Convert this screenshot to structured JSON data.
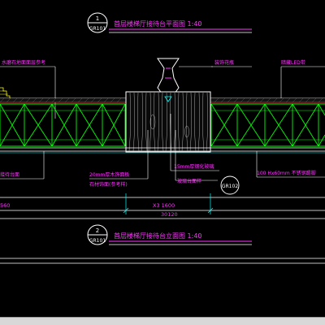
{
  "drawing": {
    "section_view": {
      "marker_number": "1",
      "marker_sheet": "GR101",
      "title": "首层楼梯厅接待台平面图 1:40"
    },
    "plan_view": {
      "marker_number": "2",
      "marker_sheet": "GR101",
      "title": "首层楼梯厅接待台立面图 1:40"
    },
    "annotations": {
      "left_top": "水磨石地面面层参考",
      "left_lower": "接待台面",
      "vase_label": "装饰花瓶",
      "right_top": "暗藏LED带",
      "mid_1": "20mm厚木饰面板",
      "mid_2": "石材饰面(参考样)",
      "center_1": "15mm厚钢化玻璃",
      "center_2": "玻璃台面样",
      "right_lower": "100 Hx60mm 不锈钢踢脚",
      "detail_ref": "GR102"
    },
    "dimensions": {
      "left": "560",
      "center": "X3 1600",
      "total": "30120"
    },
    "colors": {
      "magenta": "#ff33ff",
      "yellow": "#ffff00",
      "green": "#00ff00",
      "cyan": "#00ffff",
      "red": "#ff2a2a",
      "white": "#ffffff"
    }
  }
}
